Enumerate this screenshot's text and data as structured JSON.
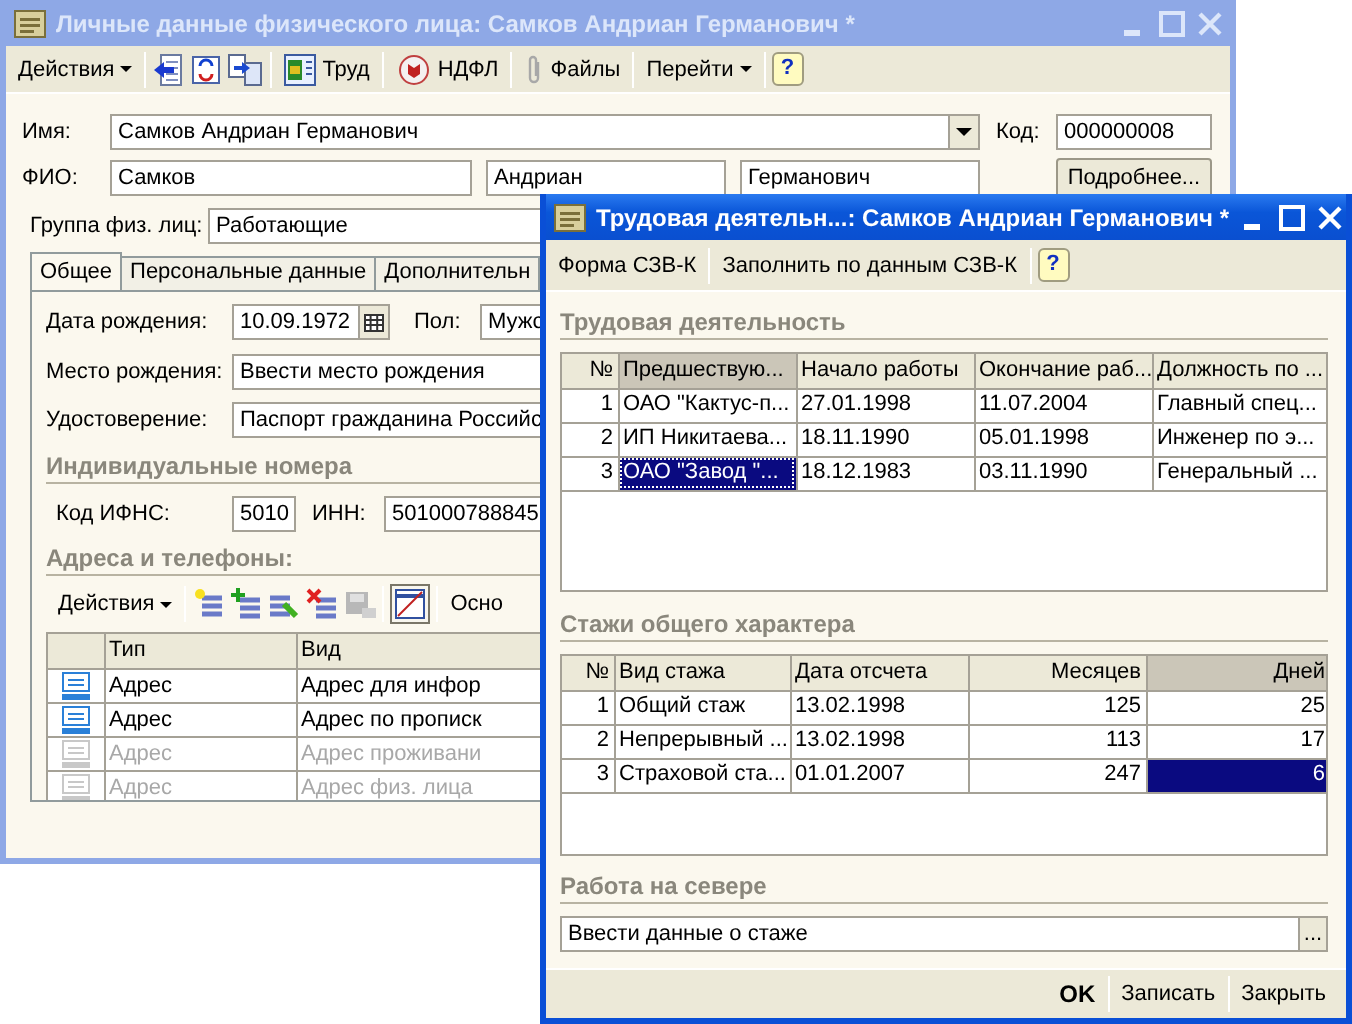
{
  "person_window": {
    "title": "Личные данные физического лица: Самков Андриан Германович *",
    "active": false,
    "toolbar": {
      "actions": "Действия",
      "labor": "Труд",
      "ndfl": "НДФЛ",
      "files": "Файлы",
      "go_to": "Перейти",
      "help": "?"
    },
    "name": {
      "label": "Имя:",
      "value": "Самков Андриан Германович"
    },
    "code": {
      "label": "Код:",
      "value": "000000008"
    },
    "full_name": {
      "label": "ФИО:",
      "surname": "Самков",
      "first_name": "Андриан",
      "patronymic": "Германович"
    },
    "details_button": "Подробнее...",
    "group": {
      "label": "Группа физ. лиц:",
      "value": "Работающие"
    },
    "tabs": [
      {
        "label": "Общее",
        "selected": true
      },
      {
        "label": "Персональные данные",
        "selected": false
      },
      {
        "label": "Дополнительн",
        "selected": false
      }
    ],
    "birth_date": {
      "label": "Дата рождения:",
      "value": "10.09.1972"
    },
    "sex": {
      "label": "Пол:",
      "value": "Мужс"
    },
    "birth_place": {
      "label": "Место рождения:",
      "value": "Ввести место рождения"
    },
    "id_document": {
      "label": "Удостоверение:",
      "value": "Паспорт гражданина Российс"
    },
    "numbers_section": "Индивидуальные номера",
    "ifns_code": {
      "label": "Код ИФНС:",
      "value": "5010"
    },
    "inn": {
      "label": "ИНН:",
      "value": "501000788845"
    },
    "addresses_section": "Адреса и телефоны:",
    "addresses_toolbar": {
      "actions": "Действия",
      "button_7": "Осно"
    },
    "addresses_table": {
      "columns": [
        "Тип",
        "Вид"
      ],
      "rows": [
        {
          "cells": [
            "Адрес",
            "Адрес для инфор"
          ],
          "enabled": true
        },
        {
          "cells": [
            "Адрес",
            "Адрес по прописк"
          ],
          "enabled": true
        },
        {
          "cells": [
            "Адрес",
            "Адрес проживани"
          ],
          "enabled": false
        },
        {
          "cells": [
            "Адрес",
            "Адрес физ. лица"
          ],
          "enabled": false
        }
      ]
    }
  },
  "labor_window": {
    "title": "Трудовая деятельн...: Самков Андриан Германович *",
    "active": true,
    "toolbar": {
      "form": "Форма СЗВ-К",
      "fill": "Заполнить по данным СЗВ-К",
      "help": "?"
    },
    "labor_section": "Трудовая деятельность",
    "labor_table": {
      "columns": [
        {
          "label": "№",
          "current": false,
          "right_aligned": true
        },
        {
          "label": "Предшествую...",
          "current": true,
          "right_aligned": false
        },
        {
          "label": "Начало работы",
          "current": false,
          "right_aligned": false
        },
        {
          "label": "Окончание раб...",
          "current": false,
          "right_aligned": false
        },
        {
          "label": "Должность по ...",
          "current": false,
          "right_aligned": false
        }
      ],
      "rows": [
        {
          "cells": [
            "1",
            "ОАО \"Кактус-п...",
            "27.01.1998",
            "11.07.2004",
            "Главный спец..."
          ],
          "selected": false
        },
        {
          "cells": [
            "2",
            "ИП Никитаева...",
            "18.11.1990",
            "05.01.1998",
            "Инженер по э..."
          ],
          "selected": false
        },
        {
          "cells": [
            "3",
            "ОАО \"Завод \"...",
            "18.12.1983",
            "03.11.1990",
            "Генеральный ..."
          ],
          "selected": true
        }
      ]
    },
    "seniority_section": "Стажи общего характера",
    "seniority_table": {
      "columns": [
        {
          "label": "№",
          "current": false,
          "right_aligned": true
        },
        {
          "label": "Вид стажа",
          "current": false,
          "right_aligned": false
        },
        {
          "label": "Дата отсчета",
          "current": false,
          "right_aligned": false
        },
        {
          "label": "Месяцев",
          "current": false,
          "right_aligned": true
        },
        {
          "label": "Дней",
          "current": true,
          "right_aligned": true
        }
      ],
      "rows": [
        {
          "cells": [
            "1",
            "Общий стаж",
            "13.02.1998",
            "125",
            "25"
          ],
          "selected": false
        },
        {
          "cells": [
            "2",
            "Непрерывный ...",
            "13.02.1998",
            "113",
            "17"
          ],
          "selected": false
        },
        {
          "cells": [
            "3",
            "Страховой ста...",
            "01.01.2007",
            "247",
            "6"
          ],
          "selected": true
        }
      ]
    },
    "north_section": "Работа на севере",
    "north_field": {
      "value": "Ввести данные о стаже",
      "button": "..."
    },
    "buttons": [
      {
        "label": "OK",
        "default": true
      },
      {
        "label": "Записать",
        "default": false
      },
      {
        "label": "Закрыть",
        "default": false
      }
    ]
  }
}
